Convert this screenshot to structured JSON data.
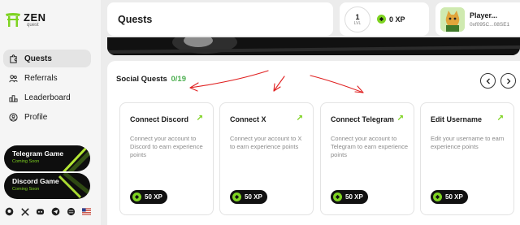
{
  "brand": {
    "name": "ZEN",
    "sub": "quest"
  },
  "nav": [
    {
      "label": "Quests",
      "icon": "puzzle-icon",
      "active": true
    },
    {
      "label": "Referrals",
      "icon": "users-icon",
      "active": false
    },
    {
      "label": "Leaderboard",
      "icon": "ranking-icon",
      "active": false
    },
    {
      "label": "Profile",
      "icon": "user-circle-icon",
      "active": false
    }
  ],
  "promos": [
    {
      "title": "Telegram Game",
      "status": "Coming Soon"
    },
    {
      "title": "Discord Game",
      "status": "Coming Soon"
    }
  ],
  "socials": [
    "github-icon",
    "x-icon",
    "discord-icon",
    "telegram-icon",
    "globe-icon",
    "us-flag-icon"
  ],
  "header": {
    "title": "Quests"
  },
  "stats": {
    "level": "1",
    "level_label": "LVL",
    "xp": "0 XP"
  },
  "profile": {
    "name": "Player...",
    "address": "0xf095C...08SE1"
  },
  "section": {
    "title": "Social Quests",
    "progress": "0/19"
  },
  "quests": [
    {
      "title": "Connect Discord",
      "description": "Connect your account to Discord to earn experience points",
      "reward": "50 XP"
    },
    {
      "title": "Connect X",
      "description": "Connect your account to X to earn experience points",
      "reward": "50 XP"
    },
    {
      "title": "Connect Telegram",
      "description": "Connect your account to Telegram to earn experience points",
      "reward": "50 XP"
    },
    {
      "title": "Edit Username",
      "description": "Edit your username to earn experience points",
      "reward": "50 XP"
    }
  ],
  "colors": {
    "accent": "#7ed321",
    "annotation": "#e02020",
    "dark": "#111111"
  }
}
